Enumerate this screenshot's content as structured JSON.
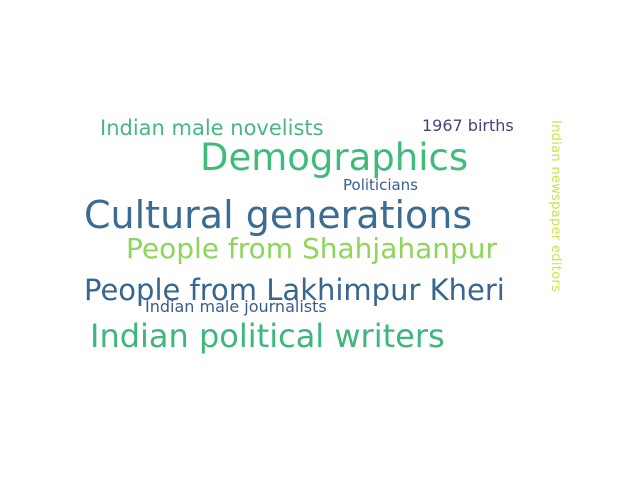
{
  "words": [
    {
      "text": "Cultural generations",
      "color": "#3b6c92"
    },
    {
      "text": "Demographics",
      "color": "#3dbc7a"
    },
    {
      "text": "Indian political writers",
      "color": "#3db77b"
    },
    {
      "text": "People from Lakhimpur Kheri",
      "color": "#37668e"
    },
    {
      "text": "People from Shahjahanpur",
      "color": "#8fd55a"
    },
    {
      "text": "Indian male novelists",
      "color": "#47b881"
    },
    {
      "text": "1967 births",
      "color": "#4a3f7e"
    },
    {
      "text": "Politicians",
      "color": "#3a5f8e"
    },
    {
      "text": "Indian male journalists",
      "color": "#3a5a8a"
    },
    {
      "text": "Indian newspaper editors",
      "color": "#d0e04e"
    }
  ]
}
